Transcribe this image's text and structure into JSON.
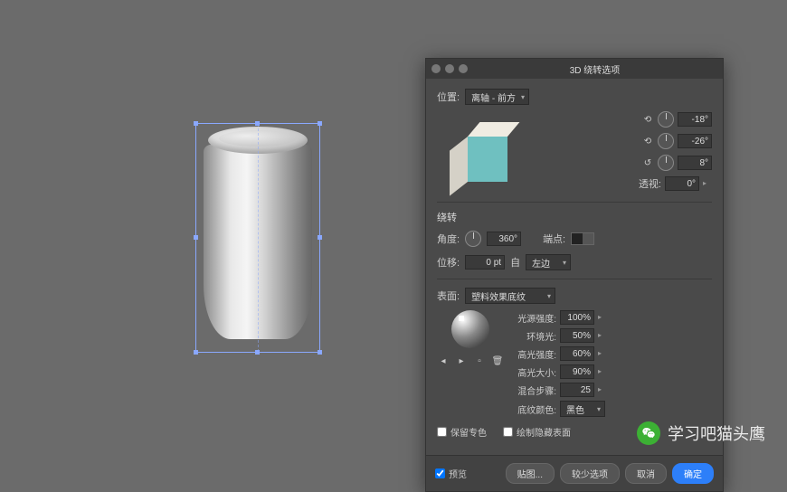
{
  "dialog": {
    "title": "3D 绕转选项",
    "position_label": "位置:",
    "position_value": "离轴 - 前方",
    "rotation": {
      "x_label": "-18°",
      "y_label": "-26°",
      "z_label": "8°",
      "perspective_label": "透视:",
      "perspective_value": "0°"
    },
    "revolve": {
      "section": "绕转",
      "angle_label": "角度:",
      "angle_value": "360°",
      "cap_label": "端点:",
      "offset_label": "位移:",
      "offset_value": "0 pt",
      "from_label": "自",
      "from_value": "左边"
    },
    "surface": {
      "section_label": "表面:",
      "type_value": "塑料效果底纹",
      "light_intensity_label": "光源强度:",
      "light_intensity_value": "100%",
      "ambient_label": "环境光:",
      "ambient_value": "50%",
      "highlight_intensity_label": "高光强度:",
      "highlight_intensity_value": "60%",
      "highlight_size_label": "高光大小:",
      "highlight_size_value": "90%",
      "blend_steps_label": "混合步骤:",
      "blend_steps_value": "25",
      "shading_color_label": "底纹颜色:",
      "shading_color_value": "黑色",
      "preserve_spot_label": "保留专色",
      "draw_hidden_label": "绘制隐藏表面"
    },
    "footer": {
      "preview_label": "预览",
      "map_art_label": "贴图...",
      "fewer_options_label": "较少选项",
      "cancel_label": "取消",
      "ok_label": "确定"
    }
  },
  "watermark": {
    "text": "学习吧猫头鹰"
  }
}
